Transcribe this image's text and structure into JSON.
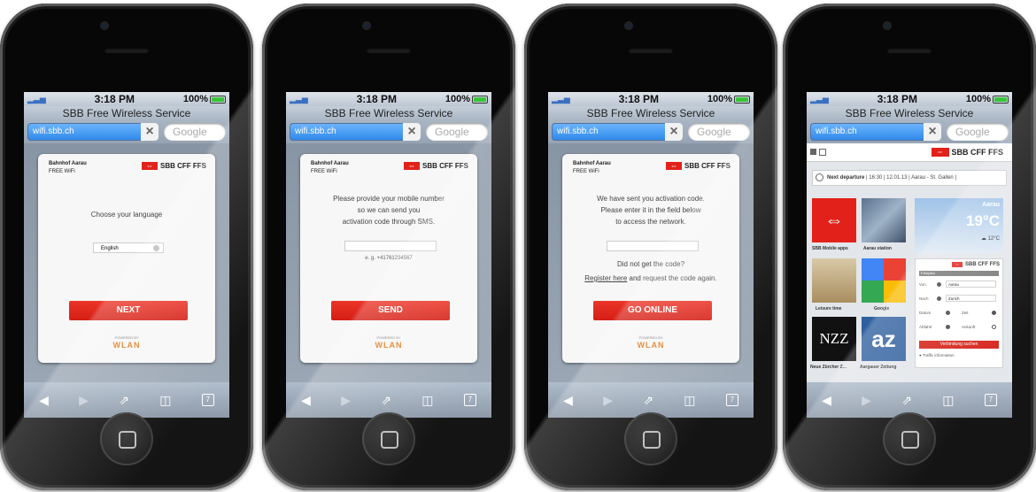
{
  "status": {
    "time": "3:18 PM",
    "battery": "100%"
  },
  "browser": {
    "title": "SBB Free Wireless Service",
    "url": "wifi.sbb.ch",
    "search_placeholder": "Google",
    "tabs_count": "7"
  },
  "brand": {
    "logo_text": "SBB CFF FFS",
    "flag_glyph": "⇔",
    "station": "Bahnhof Aarau",
    "subtitle": "FREE WiFi",
    "powered_by": "POWERED BY",
    "wlan": "WLAN"
  },
  "screens": {
    "language": {
      "prompt": "Choose your language",
      "selected_language": "English",
      "button": "NEXT"
    },
    "phone_number": {
      "line1": "Please provide your mobile number",
      "line2": "so we can send you",
      "line3": "activation code through SMS.",
      "example": "e. g. +41761234567",
      "button": "SEND"
    },
    "activation": {
      "line1": "We have sent you activation code.",
      "line2": "Please enter  it in the field below",
      "line3": "to access the network.",
      "not_received": "Did not get the code?",
      "register_link": "Register here",
      "register_rest": "and request the code again.",
      "button": "GO ONLINE"
    },
    "portal": {
      "next_departure_label": "Next departure",
      "next_departure_info": "| 16:30 | 12.01.13 | Aarau - St. Gallen |",
      "tiles": [
        {
          "label": "SBB Mobile apps"
        },
        {
          "label": "Aarau station"
        },
        {
          "label": "Leisure time"
        },
        {
          "label": "Google"
        },
        {
          "label": "Neue Zürcher Z..."
        },
        {
          "label": "Aargauer Zeitung"
        }
      ],
      "weather": {
        "city": "Aarau",
        "temp": "19°C",
        "secondary": "12°C"
      },
      "timetable": {
        "title": "Fahrplan",
        "from_label": "Von",
        "from_value": "Aarau",
        "to_label": "Nach",
        "to_value": "Zurich",
        "date_label": "Datum",
        "time_label": "Zeit",
        "depart_label": "Abfahrt",
        "arrive_label": "Ankunft",
        "search_button": "Verbindung suchen",
        "traffic": "Traffic information"
      },
      "nzz_logo": "NZZ",
      "az_logo": "az"
    }
  }
}
